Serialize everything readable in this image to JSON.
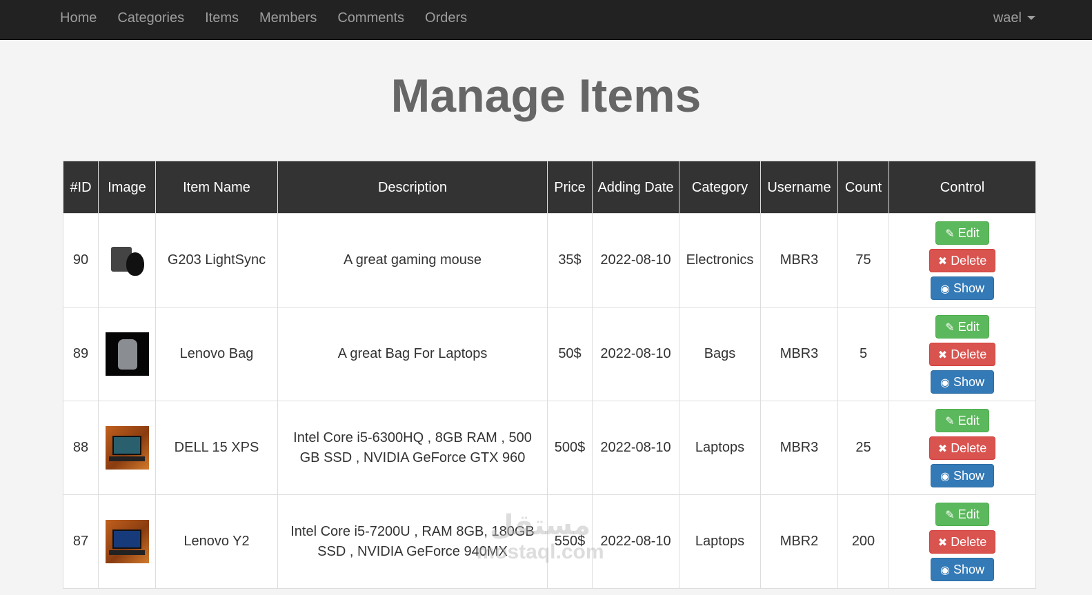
{
  "nav": {
    "links": [
      "Home",
      "Categories",
      "Items",
      "Members",
      "Comments",
      "Orders"
    ],
    "user": "wael"
  },
  "page_title": "Manage Items",
  "table": {
    "headers": [
      "#ID",
      "Image",
      "Item Name",
      "Description",
      "Price",
      "Adding Date",
      "Category",
      "Username",
      "Count",
      "Control"
    ],
    "rows": [
      {
        "id": "90",
        "image_icon": "gaming-mouse-image",
        "name": "G203 LightSync",
        "description": "A great gaming mouse",
        "price": "35$",
        "date": "2022-08-10",
        "category": "Electronics",
        "username": "MBR3",
        "count": "75"
      },
      {
        "id": "89",
        "image_icon": "laptop-bag-image",
        "name": "Lenovo Bag",
        "description": "A great Bag For Laptops",
        "price": "50$",
        "date": "2022-08-10",
        "category": "Bags",
        "username": "MBR3",
        "count": "5"
      },
      {
        "id": "88",
        "image_icon": "laptop-image",
        "name": "DELL 15 XPS",
        "description": "Intel Core i5-6300HQ , 8GB RAM , 500 GB SSD , NVIDIA GeForce GTX 960",
        "price": "500$",
        "date": "2022-08-10",
        "category": "Laptops",
        "username": "MBR3",
        "count": "25"
      },
      {
        "id": "87",
        "image_icon": "laptop-image",
        "name": "Lenovo Y2",
        "description": "Intel Core i5-7200U , RAM 8GB, 180GB SSD , NVIDIA GeForce 940MX",
        "price": "550$",
        "date": "2022-08-10",
        "category": "Laptops",
        "username": "MBR2",
        "count": "200"
      }
    ],
    "control": {
      "edit": "Edit",
      "delete": "Delete",
      "show": "Show"
    }
  },
  "watermark": {
    "arabic": "مستقل",
    "latin": "mostaql.com"
  },
  "colors": {
    "navbar": "#222222",
    "edit": "#5cb85c",
    "delete": "#d9534f",
    "show": "#337ab7",
    "header": "#333333"
  }
}
